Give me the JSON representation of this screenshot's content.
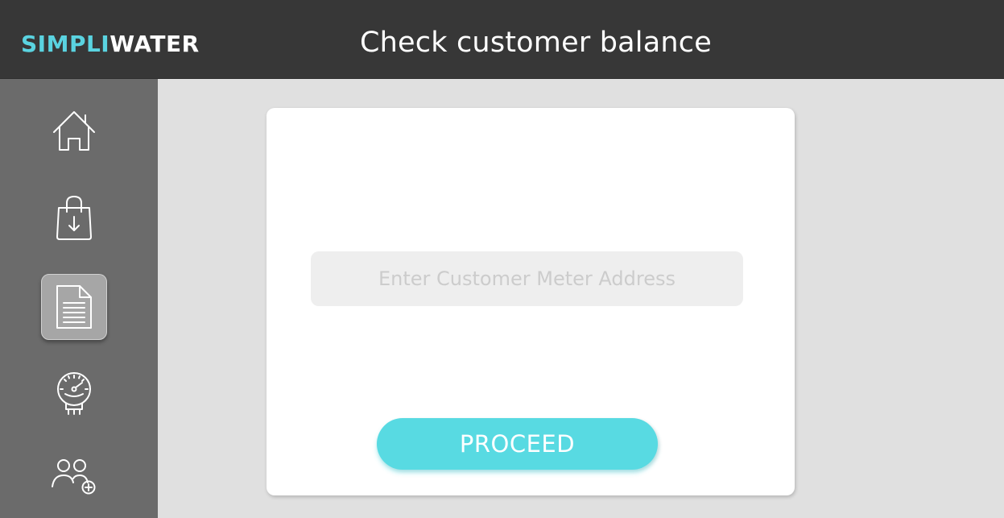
{
  "app": {
    "logo": {
      "part1": "SIMPLI",
      "part2": "WATER"
    },
    "title": "Check customer balance"
  },
  "sidebar": {
    "items": [
      {
        "id": "home",
        "icon": "home-icon",
        "active": false
      },
      {
        "id": "purchase",
        "icon": "shopping-bag-download-icon",
        "active": false
      },
      {
        "id": "balance",
        "icon": "document-icon",
        "active": true
      },
      {
        "id": "meter",
        "icon": "water-meter-gauge-icon",
        "active": false
      },
      {
        "id": "customers",
        "icon": "add-users-icon",
        "active": false
      }
    ]
  },
  "form": {
    "meter_address": {
      "value": "",
      "placeholder": "Enter Customer Meter Address"
    },
    "proceed_label": "PROCEED"
  },
  "colors": {
    "accent": "#58dae2",
    "header": "#373737",
    "sidebar": "#6b6b6b",
    "content_bg": "#e0e0e0",
    "card": "#ffffff"
  }
}
